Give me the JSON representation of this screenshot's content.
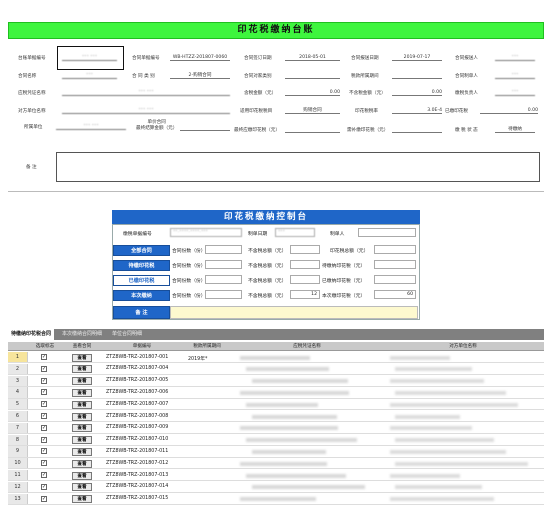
{
  "ledger": {
    "title": "印花税缴纳台账",
    "fields": {
      "ledger_no_label": "台账单据编号",
      "ledger_no_value": "*** ***",
      "contract_no_label": "合同单据编号",
      "contract_no_value": "WB-HTZZ-201807-0060",
      "sign_date_label": "合同签订日期",
      "sign_date_value": "2018-05-01",
      "report_date_label": "合同报送日期",
      "report_date_value": "2019-07-17",
      "reporter_label": "合同报送人",
      "reporter_value": "***",
      "contract_name_label": "合同名称",
      "contract_name_value": "***",
      "contract_type_label": "合 同 类 别",
      "contract_type_value": "2-购销合同",
      "counterparty_type_label": "合同对家类别",
      "counterparty_type_value": "",
      "tax_period_label": "税款所属期间",
      "tax_period_value": "",
      "maker_label": "合同制单人",
      "maker_value": "***",
      "voucher_label": "应税凭证名称",
      "voucher_value": "*** ***",
      "amount_label": "含税金额（元）",
      "amount_value": "0.00",
      "amount_ex_label": "不含税金额（元）",
      "amount_ex_value": "0.00",
      "owner_label": "缴税负责人",
      "owner_value": "***",
      "party_label": "对方单位名称",
      "party_value": "*** ***",
      "tax_item_label": "适用印花税税目",
      "tax_item_value": "购销合同",
      "tax_rate_label": "印花税税率",
      "tax_rate_value": "3.0E-4",
      "paid_tax_label": "已缴印花税",
      "paid_tax_value": "0.00",
      "unit_label": "所属单位",
      "unit_value": "*** ***",
      "basis_label": "单价合同\n最终结算金额（元）",
      "final_tax_label": "最终应缴印花税（元）",
      "refund_label": "需补缴印花税（元）",
      "status_label": "缴 税 状 态",
      "status_value": "待缴纳",
      "note_label": "备  注"
    }
  },
  "control": {
    "title": "印花税缴纳控制台",
    "bill_no_label": "缴税单据编号",
    "bill_no_value": "**-****-****-***",
    "make_date_label": "制单日期",
    "make_date_value": "***",
    "maker_label": "制单人",
    "maker_value": "",
    "buttons": {
      "all": "全部合同",
      "pending": "待缴印花税",
      "paid": "已缴印花税",
      "current": "本次缴纳"
    },
    "col_count_label": "合同份数（份）",
    "col_ex_label": "不含税总额（元）",
    "col_tax_label": "印花税总额（元）",
    "col_tax_pending_label": "待缴纳印花税（元）",
    "col_tax_paid_label": "已缴纳印花税（元）",
    "col_tax_current_label": "本次缴印花税（元）",
    "current_ex_value": "12",
    "current_tax_value": "60",
    "note_label": "备  注"
  },
  "tabs": [
    "待缴纳印花税合同",
    "本次缴纳合同明细",
    "单位合同明细"
  ],
  "grid": {
    "headers": [
      "选取标志",
      "查看合同",
      "单据编号",
      "税款所属期间",
      "应税凭证名称",
      "对方单位名称"
    ],
    "view_label": "查看",
    "rows": [
      {
        "n": "1",
        "checked": "✓",
        "no": "ZTZ8WB-TRZ-201807-001",
        "period": "2019年*"
      },
      {
        "n": "2",
        "checked": "✓",
        "no": "ZTZ8WB-TRZ-201807-004",
        "period": ""
      },
      {
        "n": "3",
        "checked": "✓",
        "no": "ZTZ8WB-TRZ-201807-005",
        "period": ""
      },
      {
        "n": "4",
        "checked": "✓",
        "no": "ZTZ8WB-TRZ-201807-006",
        "period": ""
      },
      {
        "n": "5",
        "checked": "✓",
        "no": "ZTZ8WB-TRZ-201807-007",
        "period": ""
      },
      {
        "n": "6",
        "checked": "✓",
        "no": "ZTZ8WB-TRZ-201807-008",
        "period": ""
      },
      {
        "n": "7",
        "checked": "✓",
        "no": "ZTZ8WB-TRZ-201807-009",
        "period": ""
      },
      {
        "n": "8",
        "checked": "✓",
        "no": "ZTZ8WB-TRZ-201807-010",
        "period": ""
      },
      {
        "n": "9",
        "checked": "✓",
        "no": "ZTZ8WB-TRZ-201807-011",
        "period": ""
      },
      {
        "n": "10",
        "checked": "✓",
        "no": "ZTZ8WB-TRZ-201807-012",
        "period": ""
      },
      {
        "n": "11",
        "checked": "✓",
        "no": "ZTZ8WB-TRZ-201807-013",
        "period": ""
      },
      {
        "n": "12",
        "checked": "✓",
        "no": "ZTZ8WB-TRZ-201807-014",
        "period": ""
      },
      {
        "n": "13",
        "checked": "✓",
        "no": "ZTZ8WB-TRZ-201807-015",
        "period": ""
      }
    ]
  },
  "colors": {
    "ledger_title": "#3ef53e",
    "control_title": "#1f66c8",
    "note_bg": "#fdf9cf"
  }
}
